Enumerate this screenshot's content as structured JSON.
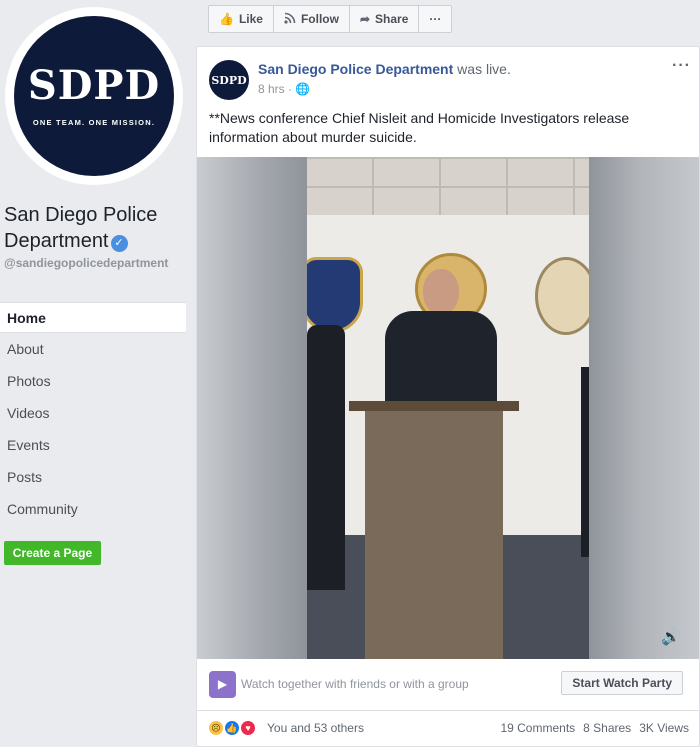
{
  "profile": {
    "logo_text": "SDPD",
    "logo_tagline": "ONE TEAM. ONE MISSION.",
    "name": "San Diego Police Department",
    "handle": "@sandiegopolicedepartment",
    "verified_icon": "check-icon"
  },
  "nav": {
    "items": [
      "Home",
      "About",
      "Photos",
      "Videos",
      "Events",
      "Posts",
      "Community"
    ],
    "active": "Home",
    "create_page": "Create a Page"
  },
  "actions": {
    "like": "Like",
    "follow": "Follow",
    "share": "Share",
    "more": "···"
  },
  "post": {
    "avatar_text": "SDPD",
    "author": "San Diego Police Department",
    "action": "was live.",
    "time": "8 hrs",
    "privacy_icon": "globe-icon",
    "text": "**News conference Chief Nisleit and Homicide Investigators release information about murder suicide.",
    "more": "···"
  },
  "watch_party": {
    "text": "Watch together with friends or with a group",
    "button": "Start Watch Party"
  },
  "reactions": {
    "summary": "You and 53 others",
    "comments": "19 Comments",
    "shares": "8 Shares",
    "views": "3K Views"
  },
  "colors": {
    "link": "#385898",
    "create_button": "#42b72a",
    "watch_icon": "#8c72cb"
  }
}
